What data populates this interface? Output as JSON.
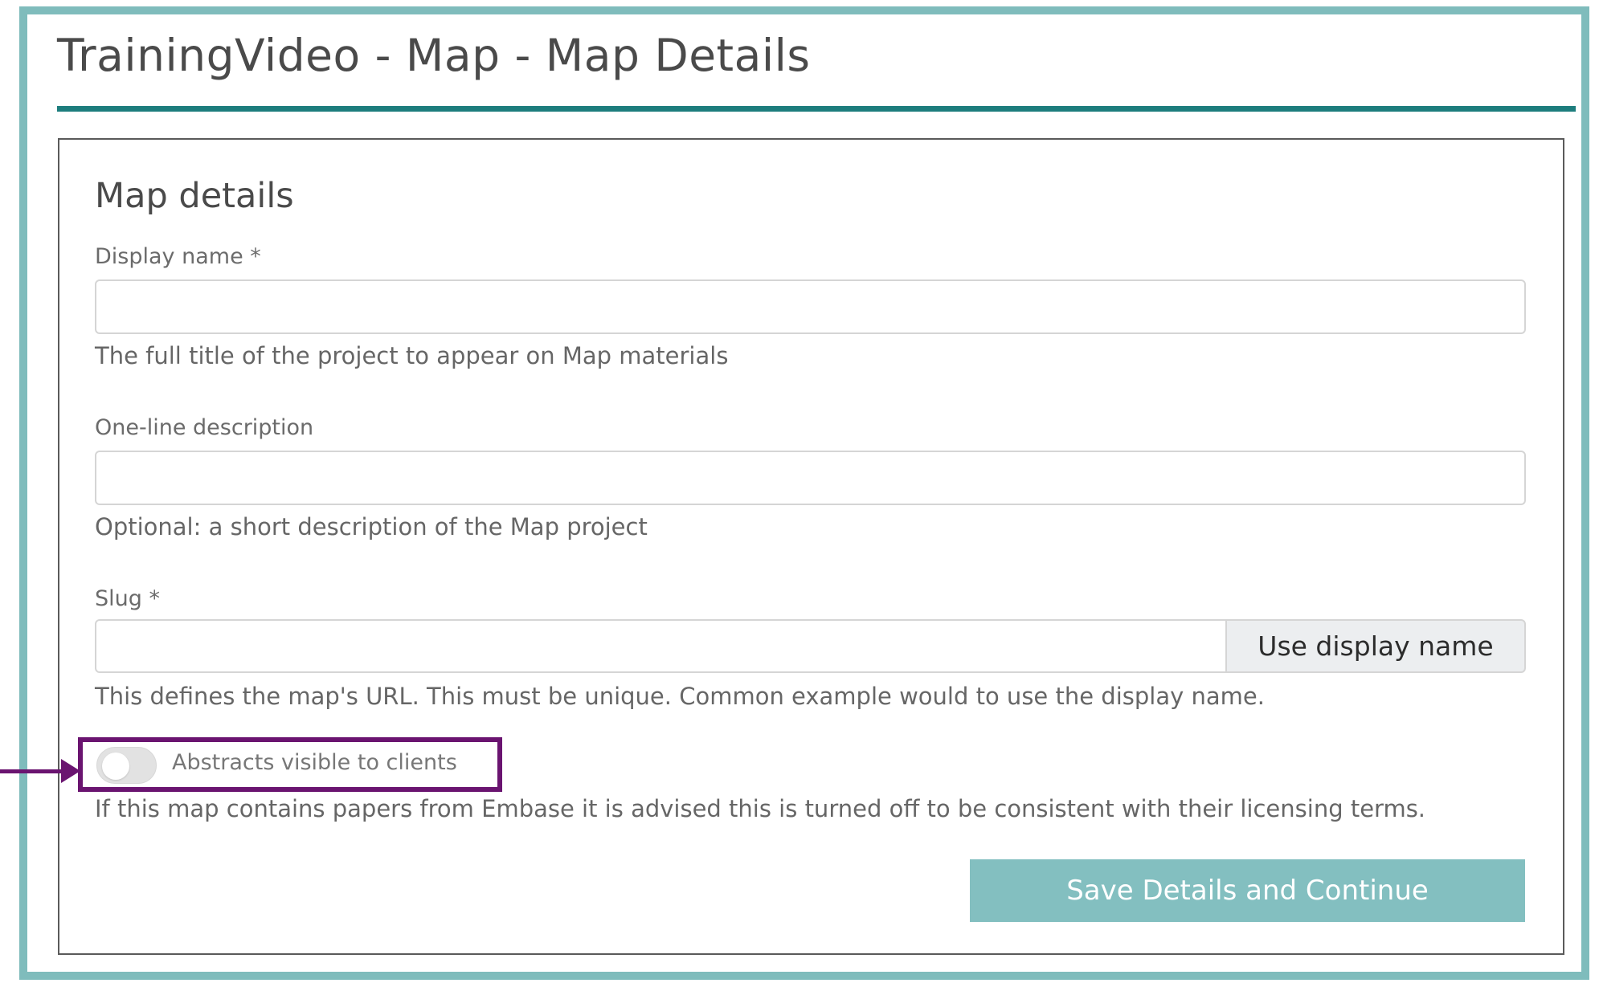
{
  "page": {
    "title": "TrainingVideo - Map - Map Details"
  },
  "form": {
    "section_title": "Map details",
    "display_name": {
      "label": "Display name *",
      "value": "",
      "help": "The full title of the project to appear on Map materials"
    },
    "description": {
      "label": "One-line description",
      "value": "",
      "help": "Optional: a short description of the Map project"
    },
    "slug": {
      "label": "Slug *",
      "value": "",
      "button_label": "Use display name",
      "help": "This defines the map's URL. This must be unique. Common example would to use the display name."
    },
    "abstracts_toggle": {
      "label": "Abstracts visible to clients",
      "state": "off",
      "help": "If this map contains papers from Embase it is advised this is turned off to be consistent with their licensing terms."
    },
    "save_label": "Save Details and Continue"
  },
  "colors": {
    "frame": "#7fbcbc",
    "title_rule": "#1d7d7d",
    "save_button": "#83bfc0",
    "annotation": "#6a1470"
  }
}
